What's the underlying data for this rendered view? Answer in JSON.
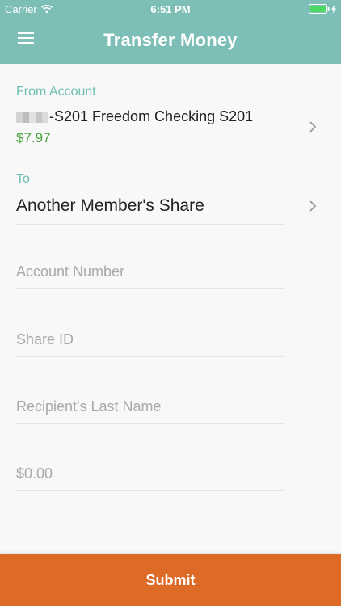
{
  "status_bar": {
    "carrier": "Carrier",
    "time": "6:51 PM",
    "battery_color": "#4cd964",
    "icons": [
      "wifi-icon",
      "battery-icon",
      "charging-bolt-icon"
    ]
  },
  "nav": {
    "title": "Transfer Money",
    "menu_icon": "hamburger-menu-icon"
  },
  "form": {
    "from_label": "From Account",
    "from_account": "-S201 Freedom Checking S201",
    "from_balance": "$7.97",
    "to_label": "To",
    "to_value": "Another Member's Share",
    "account_number_placeholder": "Account Number",
    "share_id_placeholder": "Share ID",
    "last_name_placeholder": "Recipient's Last Name",
    "amount_placeholder": "$0.00"
  },
  "submit_label": "Submit",
  "colors": {
    "header": "#7dbfb6",
    "label_teal": "#6fbfb2",
    "balance_green": "#48a33e",
    "submit_orange": "#dd6a26"
  }
}
